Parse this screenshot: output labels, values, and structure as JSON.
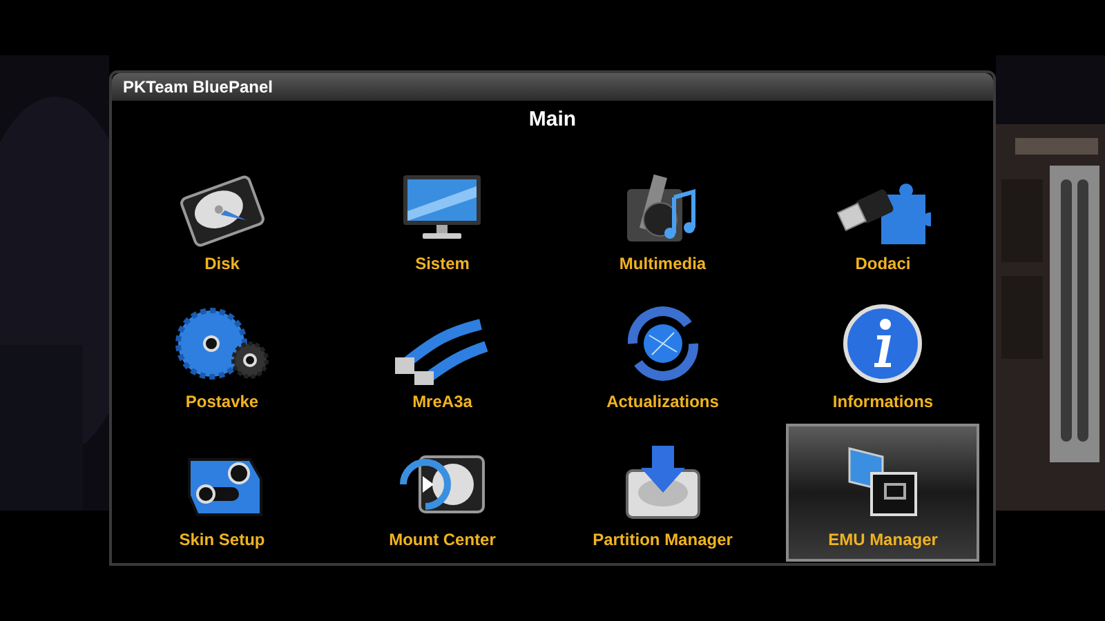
{
  "window": {
    "title": "PKTeam BluePanel"
  },
  "heading": "Main",
  "items": [
    {
      "label": "Disk",
      "selected": false
    },
    {
      "label": "Sistem",
      "selected": false
    },
    {
      "label": "Multimedia",
      "selected": false
    },
    {
      "label": "Dodaci",
      "selected": false
    },
    {
      "label": "Postavke",
      "selected": false
    },
    {
      "label": "MreA3a",
      "selected": false
    },
    {
      "label": "Actualizations",
      "selected": false
    },
    {
      "label": "Informations",
      "selected": false
    },
    {
      "label": "Skin Setup",
      "selected": false
    },
    {
      "label": "Mount Center",
      "selected": false
    },
    {
      "label": "Partition Manager",
      "selected": false
    },
    {
      "label": "EMU Manager",
      "selected": true
    }
  ]
}
